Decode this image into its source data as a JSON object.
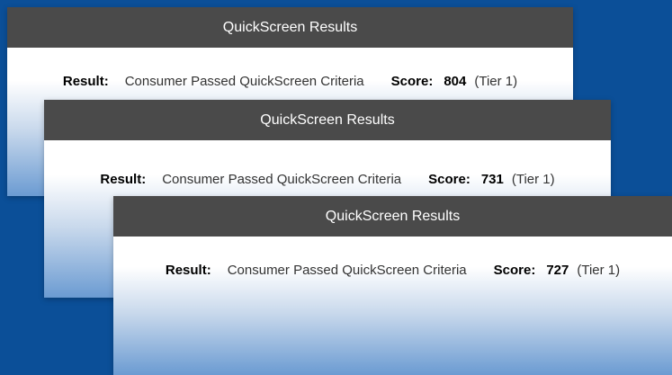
{
  "colors": {
    "background": "#0b4f98",
    "header_background": "#4a4a4a",
    "header_text": "#ffffff",
    "body_gradient_bottom": "#6b9bd2"
  },
  "cards": [
    {
      "title": "QuickScreen Results",
      "result_label": "Result:",
      "result_text": "Consumer Passed QuickScreen Criteria",
      "score_label": "Score:",
      "score_value": "804",
      "tier": "(Tier 1)"
    },
    {
      "title": "QuickScreen Results",
      "result_label": "Result:",
      "result_text": "Consumer Passed QuickScreen Criteria",
      "score_label": "Score:",
      "score_value": "731",
      "tier": "(Tier 1)"
    },
    {
      "title": "QuickScreen Results",
      "result_label": "Result:",
      "result_text": "Consumer Passed QuickScreen Criteria",
      "score_label": "Score:",
      "score_value": "727",
      "tier": "(Tier 1)"
    }
  ]
}
